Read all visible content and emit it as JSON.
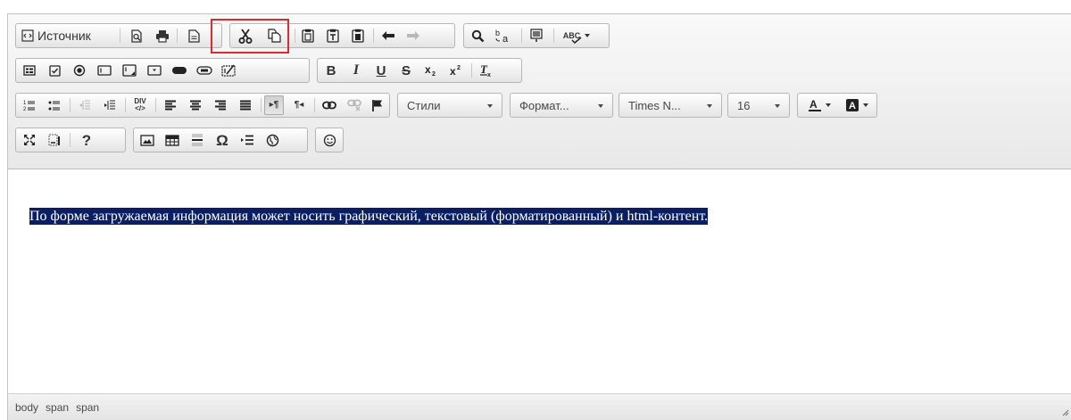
{
  "toolbar": {
    "source_label": "Источник",
    "styles_label": "Стили",
    "format_label": "Формат...",
    "font_label": "Times N...",
    "size_label": "16",
    "bold": "B",
    "italic": "I",
    "underline": "U",
    "strike": "S",
    "help": "?",
    "omega": "Ω",
    "ltr": "▸¶",
    "rtl": "¶◂",
    "spell_badge": "ABC",
    "div_badge": "DIV"
  },
  "content": {
    "text": "По форме загружаемая информация может носить графический, текстовый (форматированный) и html-контент."
  },
  "status_bar": {
    "elements": [
      "body",
      "span",
      "span"
    ]
  },
  "colors": {
    "selection": "#0a1f63",
    "highlight": "#e0292e",
    "toolbar_bg": "#ededed"
  }
}
